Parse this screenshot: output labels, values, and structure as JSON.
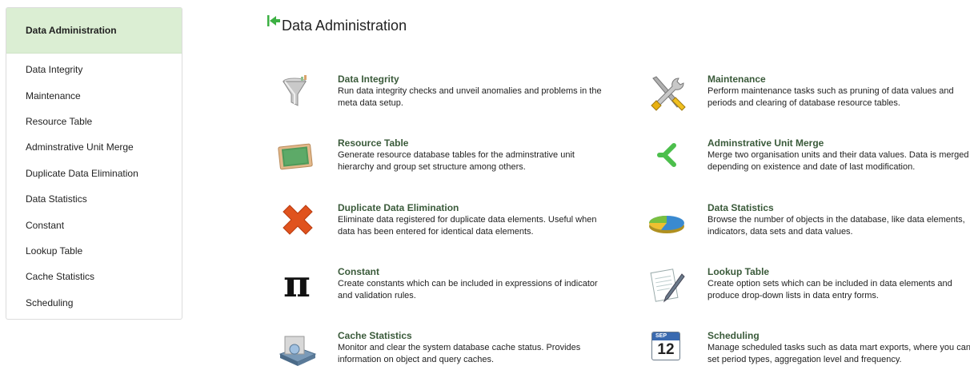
{
  "sidebar": {
    "header": "Data Administration",
    "items": [
      {
        "label": "Data Integrity"
      },
      {
        "label": "Maintenance"
      },
      {
        "label": "Resource Table"
      },
      {
        "label": "Adminstrative Unit Merge"
      },
      {
        "label": "Duplicate Data Elimination"
      },
      {
        "label": "Data Statistics"
      },
      {
        "label": "Constant"
      },
      {
        "label": "Lookup Table"
      },
      {
        "label": "Cache Statistics"
      },
      {
        "label": "Scheduling"
      }
    ]
  },
  "main": {
    "title": "Data Administration",
    "left": [
      {
        "title": "Data Integrity",
        "desc": "Run data integrity checks and unveil anomalies and problems in the meta data setup.",
        "icon": "funnel-icon"
      },
      {
        "title": "Resource Table",
        "desc": "Generate resource database tables for the adminstrative unit hierarchy and group set structure among others.",
        "icon": "chalkboard-icon"
      },
      {
        "title": "Duplicate Data Elimination",
        "desc": "Eliminate data registered for duplicate data elements. Useful when data has been entered for identical data elements.",
        "icon": "red-x-icon"
      },
      {
        "title": "Constant",
        "desc": "Create constants which can be included in expressions of indicator and validation rules.",
        "icon": "pi-icon"
      },
      {
        "title": "Cache Statistics",
        "desc": "Monitor and clear the system database cache status. Provides information on object and query caches.",
        "icon": "cache-drive-icon"
      }
    ],
    "right": [
      {
        "title": "Maintenance",
        "desc": "Perform maintenance tasks such as pruning of data values and periods and clearing of database resource tables.",
        "icon": "tools-icon"
      },
      {
        "title": "Adminstrative Unit Merge",
        "desc": "Merge two organisation units and their data values. Data is merged depending on existence and date of last modification.",
        "icon": "merge-arrow-icon"
      },
      {
        "title": "Data Statistics",
        "desc": "Browse the number of objects in the database, like data elements, indicators, data sets and data values.",
        "icon": "pie-chart-icon"
      },
      {
        "title": "Lookup Table",
        "desc": "Create option sets which can be included in data elements and produce drop-down lists in data entry forms.",
        "icon": "document-pen-icon"
      },
      {
        "title": "Scheduling",
        "desc": "Manage scheduled tasks such as data mart exports, where you can set period types, aggregation level and frequency.",
        "icon": "calendar-icon"
      }
    ],
    "calendar": {
      "month": "SEP",
      "day": "12"
    },
    "pi_symbol": "π"
  },
  "colors": {
    "sidebar_header_bg": "#dbeed3",
    "title_green": "#3a5a3a",
    "back_arrow": "#3cb043"
  }
}
